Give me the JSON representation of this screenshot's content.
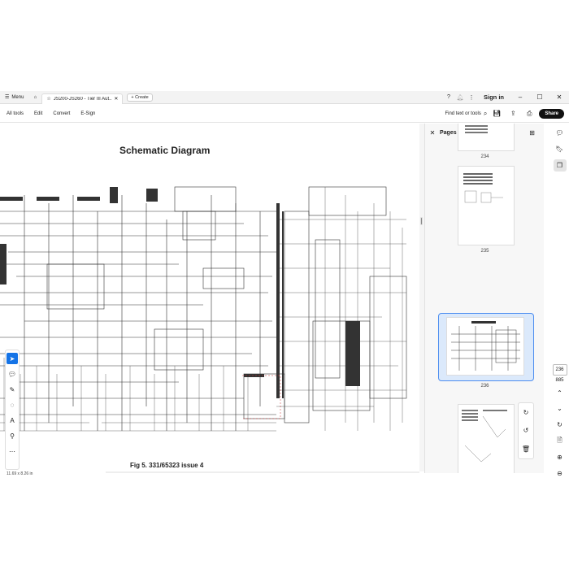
{
  "titlebar": {
    "menu_label": "Menu",
    "tab_title": "JS200-JS260 - Tier III Aut...",
    "create_label": "Create",
    "signin_label": "Sign in"
  },
  "toolbar": {
    "items": [
      "All tools",
      "Edit",
      "Convert",
      "E-Sign"
    ],
    "find_label": "Find text or tools",
    "share_label": "Share"
  },
  "document": {
    "title": "Schematic Diagram",
    "caption": "Fig 5. 331/65323 issue 4",
    "page_size": "11.69 x 8.26 in"
  },
  "pages_panel": {
    "title": "Pages",
    "thumbnails": [
      {
        "label": "234"
      },
      {
        "label": "235"
      },
      {
        "label": "236"
      },
      {
        "label": ""
      }
    ]
  },
  "navigation": {
    "current_page": "236",
    "total_pages": "885"
  },
  "colors": {
    "accent": "#1473e6",
    "selection_bg": "#dbe9fb",
    "selection_border": "#4d8ef0"
  }
}
